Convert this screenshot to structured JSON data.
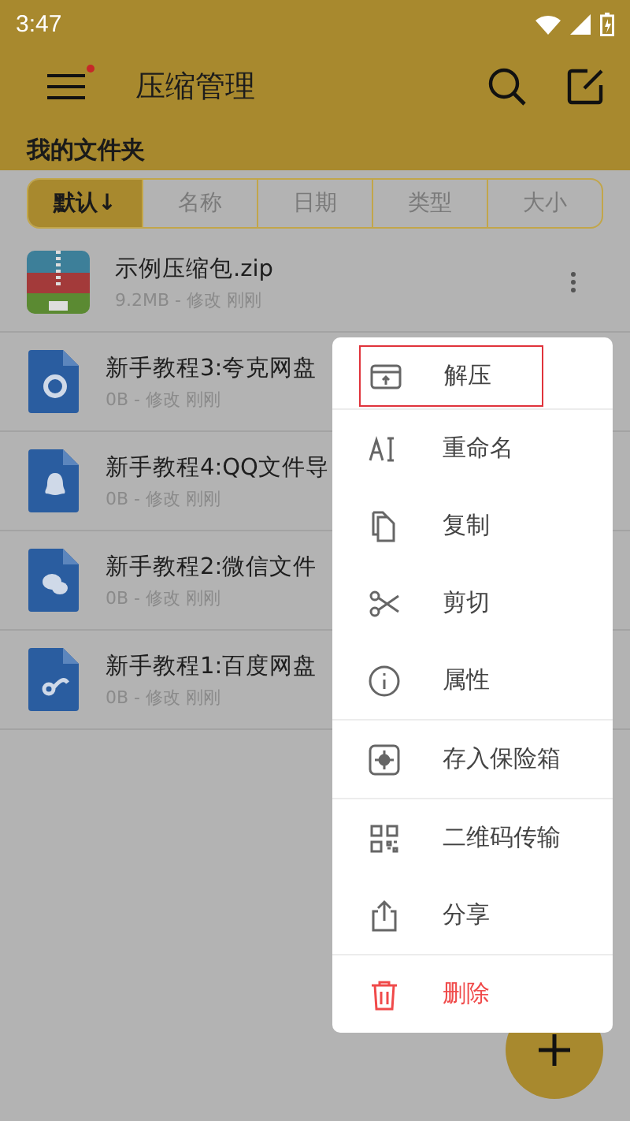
{
  "status_bar": {
    "time": "3:47"
  },
  "toolbar": {
    "title": "压缩管理",
    "menu_badge": true
  },
  "folder": {
    "title": "我的文件夹"
  },
  "sort_tabs": [
    {
      "label": "默认↓",
      "selected": true
    },
    {
      "label": "名称",
      "selected": false
    },
    {
      "label": "日期",
      "selected": false
    },
    {
      "label": "类型",
      "selected": false
    },
    {
      "label": "大小",
      "selected": false
    }
  ],
  "files": [
    {
      "kind": "zip",
      "name": "示例压缩包.zip",
      "meta": "9.2MB - 修改 刚刚"
    },
    {
      "kind": "quark",
      "name": "新手教程3:夸克网盘",
      "meta": "0B - 修改 刚刚"
    },
    {
      "kind": "qq",
      "name": "新手教程4:QQ文件导",
      "meta": "0B - 修改 刚刚"
    },
    {
      "kind": "wechat",
      "name": "新手教程2:微信文件",
      "meta": "0B - 修改 刚刚"
    },
    {
      "kind": "baidu",
      "name": "新手教程1:百度网盘",
      "meta": "0B - 修改 刚刚"
    }
  ],
  "context_menu": {
    "sections": [
      [
        {
          "kind": "extract",
          "label": "解压",
          "highlighted": true
        }
      ],
      [
        {
          "kind": "rename",
          "label": "重命名",
          "highlighted": false
        },
        {
          "kind": "copy",
          "label": "复制",
          "highlighted": false
        },
        {
          "kind": "cut",
          "label": "剪切",
          "highlighted": false
        },
        {
          "kind": "info",
          "label": "属性",
          "highlighted": false
        }
      ],
      [
        {
          "kind": "vault",
          "label": "存入保险箱",
          "highlighted": false
        }
      ],
      [
        {
          "kind": "qr",
          "label": "二维码传输",
          "highlighted": false
        },
        {
          "kind": "share",
          "label": "分享",
          "highlighted": false
        }
      ],
      [
        {
          "kind": "delete",
          "label": "删除",
          "highlighted": false
        }
      ]
    ]
  }
}
